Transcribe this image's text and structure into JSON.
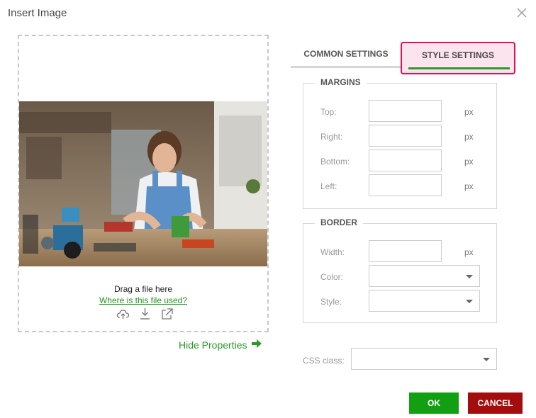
{
  "dialog": {
    "title": "Insert Image",
    "close_icon": "close-icon"
  },
  "upload": {
    "drag_text": "Drag a file here",
    "link_text": "Where is this file used?",
    "icons": [
      "upload-cloud-icon",
      "download-icon",
      "open-external-icon"
    ],
    "toggle_label": "Hide Properties",
    "toggle_icon": "arrow-right-icon"
  },
  "tabs": [
    {
      "label": "COMMON SETTINGS",
      "active": false
    },
    {
      "label": "STYLE SETTINGS",
      "active": true
    }
  ],
  "margins": {
    "legend": "MARGINS",
    "rows": [
      {
        "label": "Top:",
        "value": "",
        "unit": "px"
      },
      {
        "label": "Right:",
        "value": "",
        "unit": "px"
      },
      {
        "label": "Bottom:",
        "value": "",
        "unit": "px"
      },
      {
        "label": "Left:",
        "value": "",
        "unit": "px"
      }
    ]
  },
  "border": {
    "legend": "BORDER",
    "width_label": "Width:",
    "width_value": "",
    "width_unit": "px",
    "color_label": "Color:",
    "color_value": "",
    "style_label": "Style:",
    "style_value": ""
  },
  "css_class": {
    "label": "CSS class:",
    "value": ""
  },
  "buttons": {
    "ok": "OK",
    "cancel": "CANCEL"
  },
  "colors": {
    "accent_green": "#12a012",
    "cancel_red": "#a30d0d",
    "highlight_pink": "#fce4ee",
    "highlight_border": "#e0105a"
  }
}
